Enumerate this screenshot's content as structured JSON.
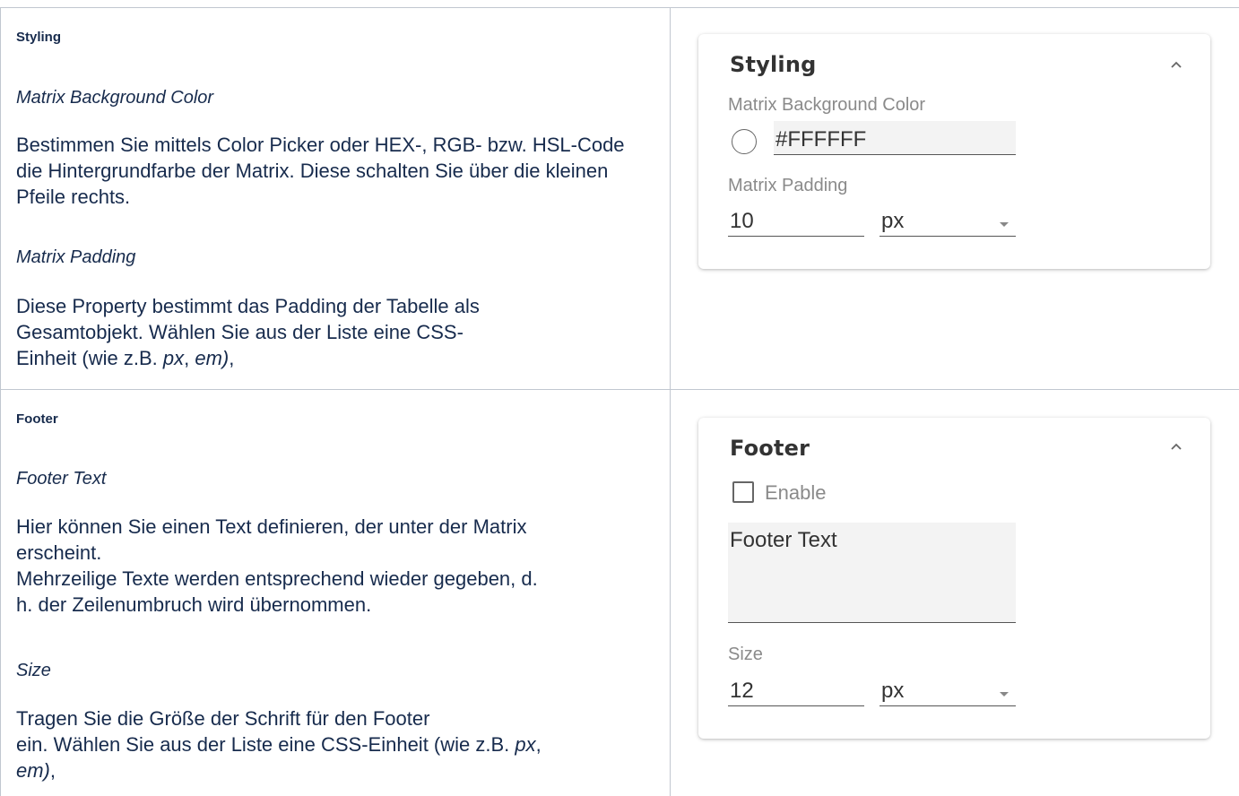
{
  "styling_doc": {
    "title": "Styling",
    "sub1": "Matrix Background Color",
    "p1": "Bestimmen Sie mittels Color Picker oder HEX-, RGB- bzw. HSL-Code die Hintergrundfarbe der Matrix. Diese schalten Sie über die kleinen Pfeile rechts.",
    "sub2": "Matrix Padding",
    "p2_lines": [
      "Diese Property bestimmt das Padding der Tabelle als",
      "Gesamtobjekt. Wählen Sie aus der Liste eine CSS-"
    ],
    "p2_end_prefix": "Einheit (wie z.B. ",
    "p2_em1": "px",
    "p2_mid": ", ",
    "p2_em2": "em)",
    "p2_suffix": ","
  },
  "styling_card": {
    "title": "Styling",
    "bg_label": "Matrix Background Color",
    "bg_value": "#FFFFFF",
    "padding_label": "Matrix Padding",
    "padding_value": "10",
    "padding_unit": "px"
  },
  "footer_doc": {
    "title": "Footer",
    "sub1": "Footer Text",
    "p1_lines": [
      "Hier können Sie einen Text definieren, der unter der Matrix",
      "erscheint.",
      "Mehrzeilige Texte werden entsprechend wieder gegeben, d.",
      "h. der Zeilenumbruch wird übernommen."
    ],
    "sub2": "Size",
    "p2_line1": "Tragen Sie die Größe der Schrift für den Footer",
    "p2_line2_prefix": "ein. Wählen Sie aus der Liste eine CSS-Einheit (wie z.B. ",
    "p2_em1": "px",
    "p2_line2_suffix": ",",
    "p2_em2": "em)",
    "p2_suffix": ","
  },
  "footer_card": {
    "title": "Footer",
    "enable_label": "Enable",
    "text_placeholder": "Footer Text",
    "size_label": "Size",
    "size_value": "12",
    "size_unit": "px"
  },
  "colors": {
    "border": "#c1c7d0",
    "text": "#172b4d",
    "label_gray": "#8a8a8a"
  }
}
